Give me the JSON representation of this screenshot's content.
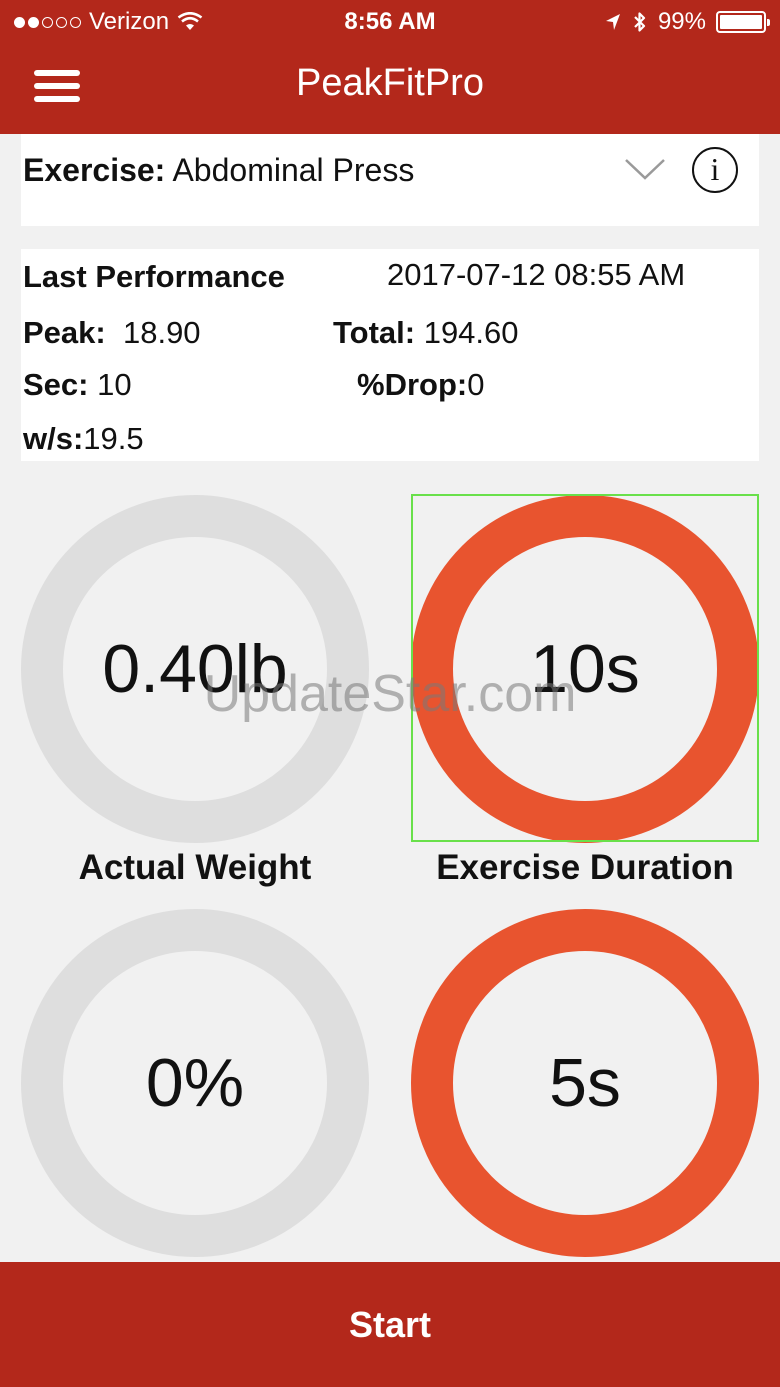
{
  "status_bar": {
    "carrier": "Verizon",
    "time": "8:56 AM",
    "battery": "99%",
    "battery_level": 0.99,
    "signal_bars_filled": 2,
    "signal_bars_total": 5
  },
  "header": {
    "title": "PeakFitPro",
    "menu_icon": "hamburger-icon"
  },
  "exercise": {
    "label": "Exercise:",
    "value": "Abdominal Press",
    "dropdown_icon": "chevron-down-icon",
    "info_icon": "info-icon"
  },
  "last_performance": {
    "title": "Last Performance",
    "timestamp": "2017-07-12 08:55 AM",
    "peak_label": "Peak:",
    "peak_value": "18.90",
    "total_label": "Total:",
    "total_value": "194.60",
    "sec_label": "Sec:",
    "sec_value": "10",
    "drop_label": "%Drop:",
    "drop_value": "0",
    "ws_label": "w/s:",
    "ws_value": "19.5"
  },
  "dials": {
    "actual_weight": {
      "value": "0.40lb",
      "label": "Actual Weight",
      "ring_color": "#dedede"
    },
    "exercise_duration": {
      "value": "10s",
      "label": "Exercise Duration",
      "ring_color": "#e8542f"
    },
    "percent": {
      "value": "0%",
      "ring_color": "#dedede"
    },
    "countdown": {
      "value": "5s",
      "ring_color": "#e8542f"
    }
  },
  "watermark": "UpdateStar.com",
  "start_button": {
    "label": "Start"
  },
  "colors": {
    "brand": "#b3281b",
    "accent": "#e8542f",
    "ring_inactive": "#dedede",
    "background": "#f1f1f1",
    "focus": "#69e04a"
  }
}
